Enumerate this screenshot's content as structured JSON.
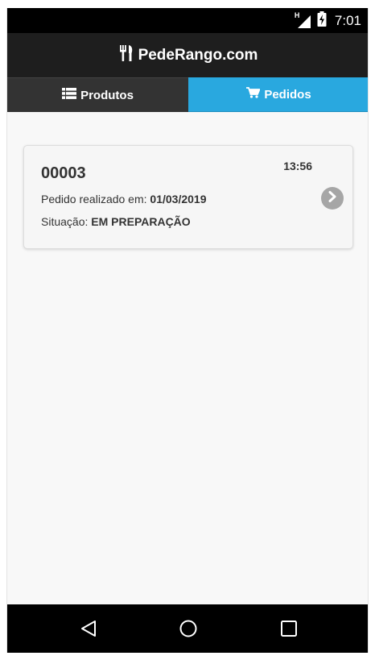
{
  "status_bar": {
    "network_label": "H",
    "time": "7:01",
    "icons": [
      "signal-icon",
      "battery-charging-icon"
    ]
  },
  "header": {
    "title": "PedeRango.com",
    "icon": "utensils-icon"
  },
  "tabs": [
    {
      "label": "Produtos",
      "icon": "list-icon",
      "active": false
    },
    {
      "label": "Pedidos",
      "icon": "cart-icon",
      "active": true
    }
  ],
  "orders": [
    {
      "number": "00003",
      "time": "13:56",
      "date_label": "Pedido realizado em:",
      "date": "01/03/2019",
      "status_label": "Situação:",
      "status": "EM PREPARAÇÃO"
    }
  ],
  "colors": {
    "header_bg": "#1e1e1e",
    "tab_inactive_bg": "#333333",
    "tab_active_bg": "#29a8df",
    "chevron_bg": "#a6a6a6",
    "page_bg": "#f8f8f8"
  },
  "nav": {
    "icons": [
      "back-icon",
      "home-icon",
      "recent-apps-icon"
    ]
  }
}
